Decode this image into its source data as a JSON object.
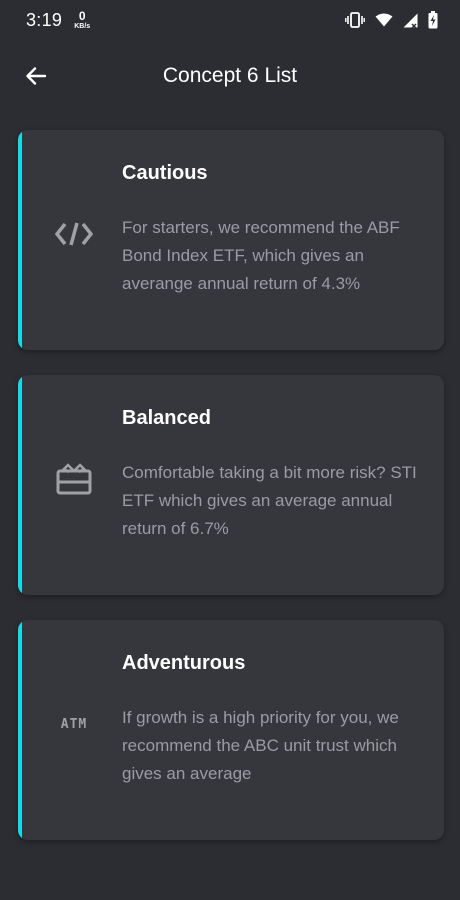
{
  "status_bar": {
    "time": "3:19",
    "net_speed_value": "0",
    "net_speed_unit": "KB/s",
    "icons": [
      "vibrate-icon",
      "wifi-icon",
      "cell-signal-icon",
      "battery-charging-icon"
    ]
  },
  "app_bar": {
    "back_icon": "arrow-left-icon",
    "title": "Concept 6 List"
  },
  "colors": {
    "background": "#2c2d32",
    "card": "#36373d",
    "accent": "#1ad9e6",
    "body_text": "#9b9ca3"
  },
  "cards": [
    {
      "icon": "code-icon",
      "title": "Cautious",
      "body": "For starters, we recommend the ABF Bond Index ETF, which gives an averange annual return of 4.3%"
    },
    {
      "icon": "gift-card-icon",
      "title": "Balanced",
      "body": "Comfortable taking a bit more risk? STI ETF which gives an average annual return of 6.7%"
    },
    {
      "icon": "atm-icon",
      "icon_text": "ATM",
      "title": "Adventurous",
      "body": "If growth is a high priority for you, we recommend the ABC unit trust which gives an average"
    }
  ]
}
